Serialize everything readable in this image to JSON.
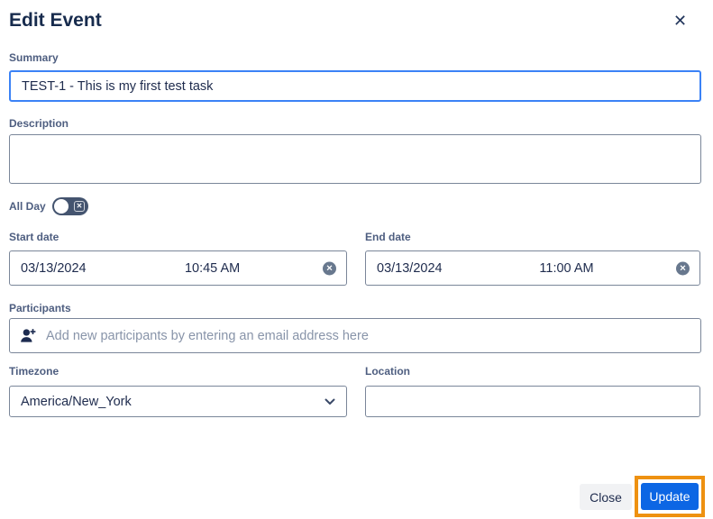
{
  "dialog": {
    "title": "Edit Event"
  },
  "form": {
    "summary": {
      "label": "Summary",
      "value": "TEST-1 - This is my first test task"
    },
    "description": {
      "label": "Description",
      "value": ""
    },
    "all_day": {
      "label": "All Day",
      "enabled": false
    },
    "start_date": {
      "label": "Start date",
      "date": "03/13/2024",
      "time": "10:45 AM"
    },
    "end_date": {
      "label": "End date",
      "date": "03/13/2024",
      "time": "11:00 AM"
    },
    "participants": {
      "label": "Participants",
      "value": "",
      "placeholder": "Add new participants by entering an email address here"
    },
    "timezone": {
      "label": "Timezone",
      "value": "America/New_York"
    },
    "location": {
      "label": "Location",
      "value": ""
    }
  },
  "footer": {
    "close_label": "Close",
    "update_label": "Update"
  },
  "icons": {
    "close": "✕",
    "clear": "✕",
    "toggle_off": "✕"
  },
  "colors": {
    "title_text": "#172B4D",
    "label_text": "#4E5E80",
    "focus_border": "#3B82F6",
    "field_border": "#7A8699",
    "toggle_bg": "#44546F",
    "primary_button": "#0C66E4",
    "secondary_button": "#F1F2F4",
    "highlight_orange": "#EE9111"
  }
}
